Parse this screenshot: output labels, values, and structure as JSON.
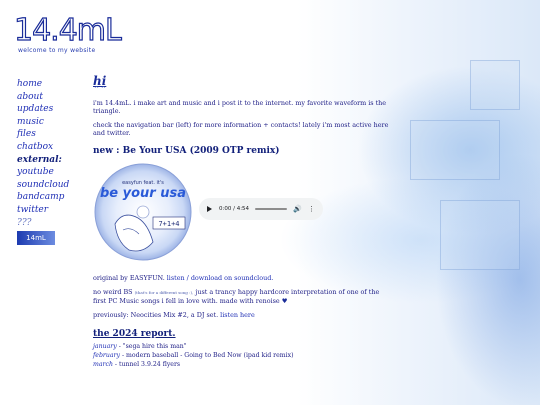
{
  "header": {
    "title": "14.4mL",
    "subtitle": "welcome to my website"
  },
  "nav": {
    "items": [
      {
        "label": "home"
      },
      {
        "label": "about"
      },
      {
        "label": "updates"
      },
      {
        "label": "music"
      },
      {
        "label": "files"
      },
      {
        "label": "chatbox"
      },
      {
        "label": "external:"
      },
      {
        "label": "youtube"
      },
      {
        "label": "soundcloud"
      },
      {
        "label": "bandcamp"
      },
      {
        "label": "twitter"
      },
      {
        "label": "???"
      }
    ],
    "badge": "14mL"
  },
  "main": {
    "greeting": "hi",
    "greeting_sub": "^ ^",
    "intro": "i'm 14.4mL. i make art and music and i post it to the internet. my favorite waveform is the triangle.",
    "nav_note": "check the navigation bar (left) for more information + contacts! lately i'm most active here and twitter.",
    "new_title": "new : Be Your USA (2009 OTP remix)",
    "cd": {
      "small_text": "easyfun feat. it's",
      "big_text": "be your usa",
      "label_text": "7+1+4"
    },
    "player": {
      "time": "0:00 / 4:54"
    },
    "credit_prefix": "original by EASYFUN. ",
    "credit_link": "listen / download on soundcloud.",
    "description_a": "no weird BS ",
    "description_small": "(that's for a different song :),",
    "description_b": " just a trancy happy hardcore interpretation of one of the first PC Music songs i fell in love with. made with renoise ",
    "description_heart": "♥",
    "previously_prefix": "previously: Neocities Mix #2, a DJ set. ",
    "previously_link": "listen here",
    "report_title": "the 2024 report.",
    "report": [
      {
        "month": "january",
        "text": " - \"sega hire this man\""
      },
      {
        "month": "february",
        "text": " - modern baseball - Going to Bed Now (ipad kid remix)"
      },
      {
        "month": "march",
        "text": " - tunnel 3.9.24 flyers"
      }
    ]
  },
  "colors": {
    "accent": "#1a2c99",
    "link": "#1f2fb5",
    "player_bg": "#f1f3f4"
  }
}
